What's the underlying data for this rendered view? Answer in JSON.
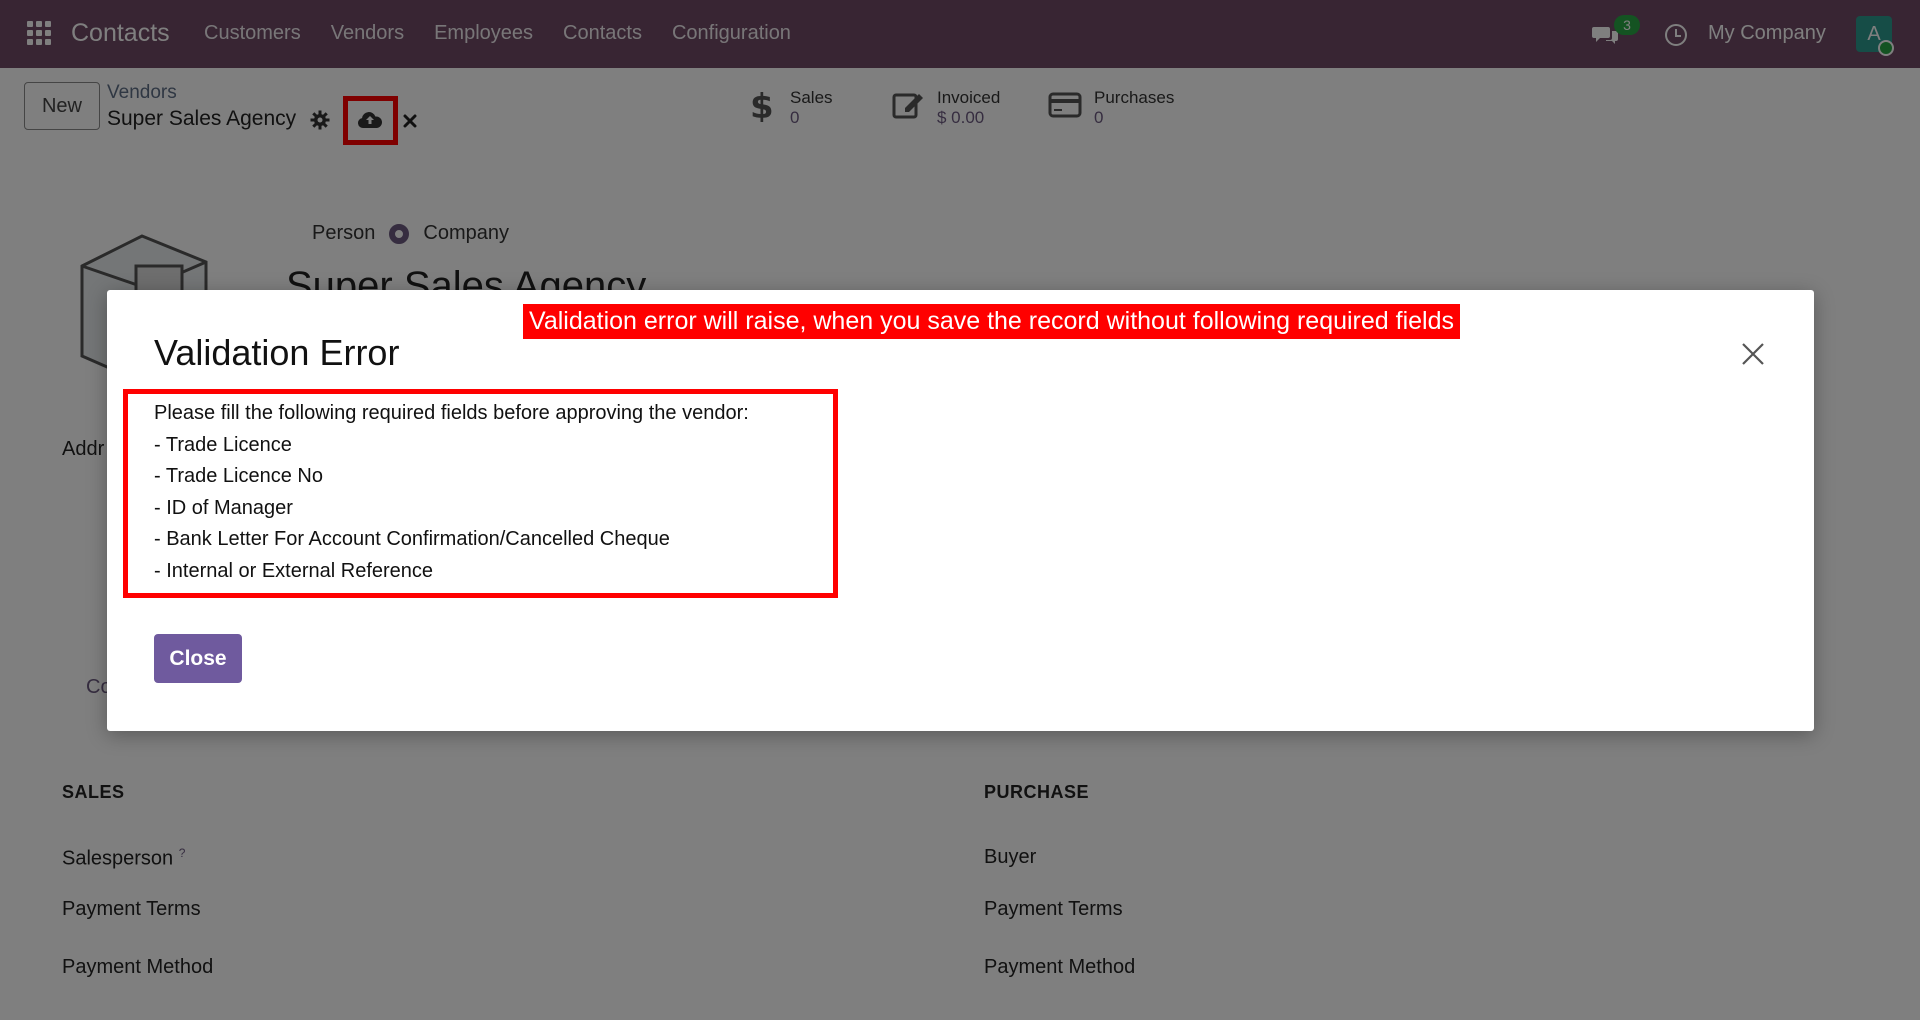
{
  "navbar": {
    "brand": "Contacts",
    "menu": [
      "Customers",
      "Vendors",
      "Employees",
      "Contacts",
      "Configuration"
    ],
    "chat_count": "3",
    "company": "My Company",
    "avatar_letter": "A"
  },
  "control_panel": {
    "new_label": "New",
    "breadcrumb_parent": "Vendors",
    "breadcrumb_current": "Super Sales Agency",
    "smart_buttons": [
      {
        "label": "Sales",
        "value": "0",
        "icon": "dollar-icon"
      },
      {
        "label": "Invoiced",
        "value": "$ 0.00",
        "icon": "edit-icon"
      },
      {
        "label": "Purchases",
        "value": "0",
        "icon": "credit-card-icon"
      }
    ]
  },
  "form": {
    "type_options": [
      "Person",
      "Company"
    ],
    "type_selected": "Company",
    "name": "Super Sales Agency",
    "address_label": "Addr",
    "co_label": "Co",
    "sales_section": "SALES",
    "purchase_section": "PURCHASE",
    "sales_fields": [
      "Salesperson",
      "Payment Terms",
      "Payment Method"
    ],
    "purchase_fields": [
      "Buyer",
      "Payment Terms",
      "Payment Method"
    ],
    "salesperson_help": "?"
  },
  "modal": {
    "title": "Validation Error",
    "annotation": "Validation error will raise, when you save the record without following required fields",
    "message_lines": [
      "Please fill the following required fields before approving the vendor:",
      "- Trade Licence",
      "- Trade Licence No",
      "- ID of Manager",
      "- Bank Letter For Account Confirmation/Cancelled Cheque",
      "- Internal or External Reference"
    ],
    "close_label": "Close"
  },
  "colors": {
    "navbar": "#714b67",
    "primary": "#6f5a9e",
    "annotation_red": "#ff0000"
  }
}
